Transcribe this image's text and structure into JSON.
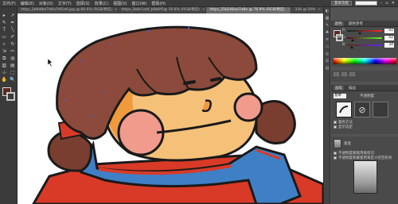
{
  "app": {
    "menu": [
      "文件(F)",
      "编辑(E)",
      "对象(O)",
      "文字(T)",
      "选择(S)",
      "效果(C)",
      "视图(V)",
      "窗口(W)",
      "帮助(H)"
    ],
    "workspace_label": "基本功能",
    "workspace_selected": "▾"
  },
  "tabs": [
    {
      "label": "https_2b9d8ef7d6a7f45a0.jpg @ 66.6% (RGB/预览)",
      "active": false
    },
    {
      "label": "https_2b8c1a4f_b0b0f5@ 50.8% (RGB/预览)",
      "active": false
    },
    {
      "label": "https_25b2d6aa7a8e @ 76.9% (RGB/预览)",
      "active": true
    },
    {
      "label": "336 @ 50%",
      "active": false
    }
  ],
  "toolbar": {
    "tools": [
      "▸",
      "↗",
      "✎",
      "✒",
      "T",
      "╲",
      "▭",
      "✐",
      "⌕",
      "↻",
      "⇲",
      "✂",
      "⧉",
      "◍",
      "▥",
      "▤",
      "⊹",
      "⬚",
      "✋",
      "🔍"
    ],
    "fill_color": "#5c2a22"
  },
  "color_panel": {
    "tabs": [
      "颜色",
      "颜色参考"
    ],
    "channels": [
      {
        "label": "R",
        "value": "92",
        "gradient": "linear-gradient(to right,#002a22,#ff2a22)"
      },
      {
        "label": "G",
        "value": "42",
        "gradient": "linear-gradient(to right,#5c0022,#5cff22)"
      },
      {
        "label": "B",
        "value": "34",
        "gradient": "linear-gradient(to right,#5c2a00,#5c2aff)"
      }
    ]
  },
  "brush_panel": {
    "tabs": [
      "画笔",
      "描边"
    ],
    "select_value": "基本",
    "tip_label": "不透明度",
    "options": [
      "着色方法",
      "显示选定"
    ],
    "footer_options": [
      "不透明度蒙版用来剪切",
      "不透明度和蒙版用来定义挖空形状"
    ]
  },
  "layer_panel": {
    "label": "渐变"
  },
  "colors": {
    "hair": "#8b4a3b",
    "face": "#f5c179",
    "cheek": "#f09b8c",
    "scarf": "#3f7fc5",
    "coat": "#d93a27",
    "outline": "#1a1a1a",
    "shade": "#f09a3e"
  }
}
